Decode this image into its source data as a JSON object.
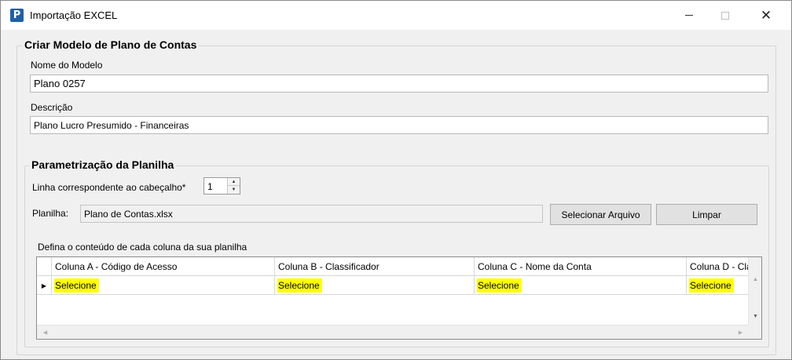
{
  "window": {
    "title": "Importação EXCEL",
    "icon_letter": "P",
    "minimize_glyph": "",
    "close_glyph": "✕"
  },
  "model_group": {
    "legend": "Criar Modelo de Plano de Contas",
    "name_label": "Nome do Modelo",
    "name_value": "Plano 0257",
    "description_label": "Descrição",
    "description_value": "Plano Lucro Presumido - Financeiras"
  },
  "sheet_group": {
    "legend": "Parametrização da Planilha",
    "header_row_label": "Linha correspondente ao cabeçalho*",
    "header_row_value": "1",
    "sheet_label": "Planilha:",
    "sheet_value": "Plano de Contas.xlsx",
    "select_file_button": "Selecionar Arquivo",
    "clear_button": "Limpar",
    "columns_caption": "Defina o conteúdo de cada coluna da sua planilha"
  },
  "grid": {
    "columns": [
      "Coluna A - Código de Acesso",
      "Coluna B - Classificador",
      "Coluna C - Nome da Conta",
      "Coluna D - Classificação"
    ],
    "row": [
      "Selecione",
      "Selecione",
      "Selecione",
      "Selecione"
    ]
  },
  "colors": {
    "highlight": "#ffff00",
    "window_bg": "#f0f0f0",
    "icon_blue": "#1f5fa6"
  },
  "icons": {
    "app": "app-logo-icon",
    "spin_up": "spin-up-arrow-icon",
    "spin_down": "spin-down-arrow-icon",
    "row_pointer": "row-pointer-icon"
  }
}
